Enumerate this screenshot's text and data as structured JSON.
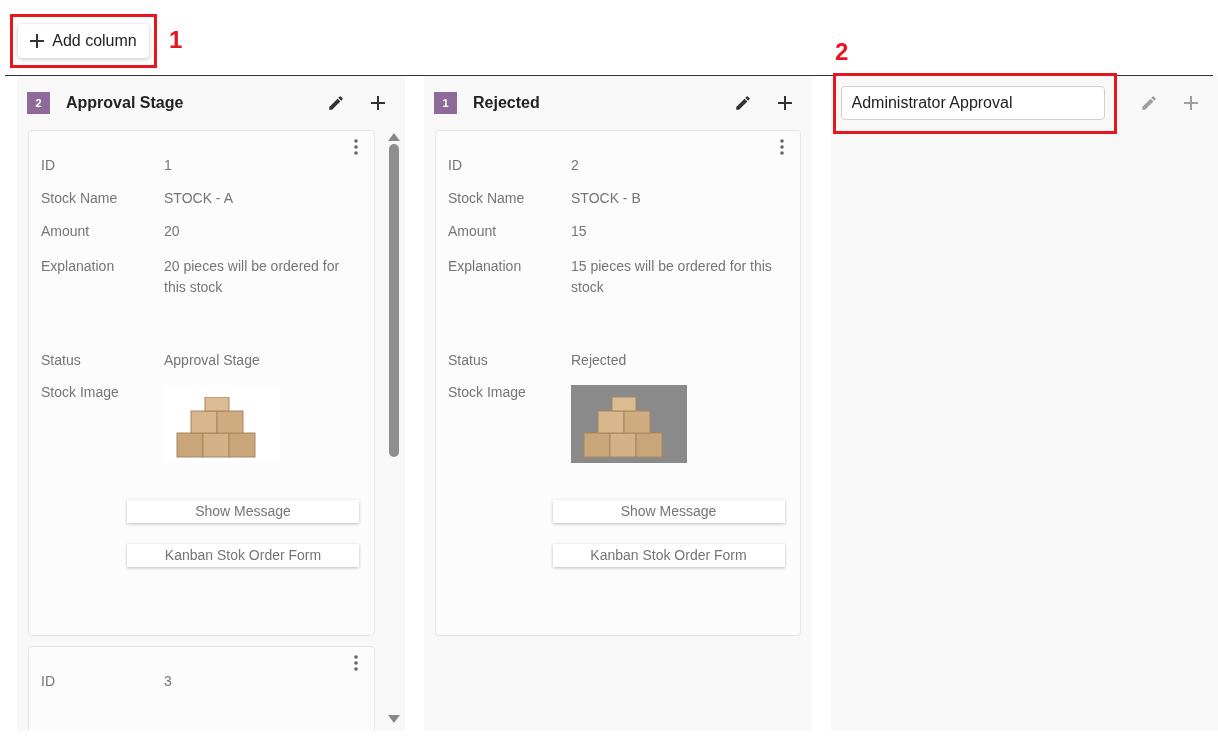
{
  "toolbar": {
    "add_column_button": {
      "label": "Add column"
    },
    "callout": "1"
  },
  "columns": [
    {
      "count": "2",
      "title": "Approval Stage",
      "editing": false,
      "scrollable": true,
      "cards": [
        {
          "fields": [
            {
              "kind": "text",
              "label": "ID",
              "value": "1"
            },
            {
              "kind": "text",
              "label": "Stock Name",
              "value": "STOCK - A"
            },
            {
              "kind": "text",
              "label": "Amount",
              "value": "20"
            },
            {
              "kind": "multiline",
              "label": "Explanation",
              "value": "20 pieces will be ordered for this stock"
            },
            {
              "kind": "text",
              "label": "Status",
              "value": "Approval Stage"
            },
            {
              "kind": "image_on_white",
              "label": "Stock Image"
            }
          ],
          "buttons": [
            "Show Message",
            "Kanban Stok Order Form"
          ]
        },
        {
          "fields": [
            {
              "kind": "text",
              "label": "ID",
              "value": "3"
            }
          ]
        }
      ]
    },
    {
      "count": "1",
      "title": "Rejected",
      "editing": false,
      "scrollable": false,
      "cards": [
        {
          "fields": [
            {
              "kind": "text",
              "label": "ID",
              "value": "2"
            },
            {
              "kind": "text",
              "label": "Stock Name",
              "value": "STOCK - B"
            },
            {
              "kind": "text",
              "label": "Amount",
              "value": "15"
            },
            {
              "kind": "multiline",
              "label": "Explanation",
              "value": "15 pieces will be ordered for this stock"
            },
            {
              "kind": "text",
              "label": "Status",
              "value": "Rejected"
            },
            {
              "kind": "image_on_gray",
              "label": "Stock Image"
            }
          ],
          "buttons": [
            "Show Message",
            "Kanban Stok Order Form"
          ]
        }
      ]
    },
    {
      "title": "Administrator Approval",
      "editing": true,
      "scrollable": false,
      "callout": "2"
    }
  ]
}
